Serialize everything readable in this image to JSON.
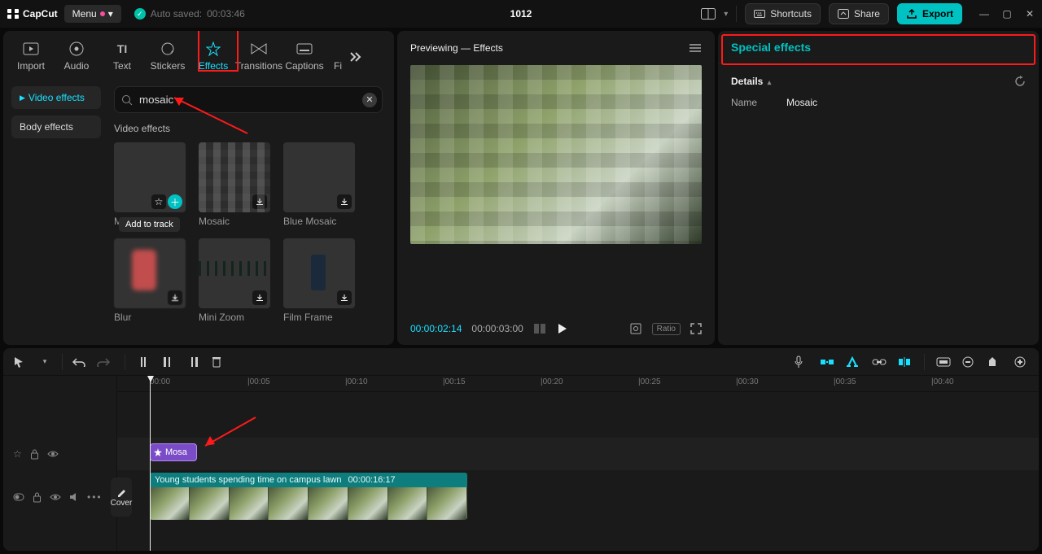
{
  "titlebar": {
    "app_name": "CapCut",
    "menu_label": "Menu",
    "autosave_label": "Auto saved:",
    "autosave_time": "00:03:46",
    "project_title": "1012",
    "shortcuts_label": "Shortcuts",
    "share_label": "Share",
    "export_label": "Export"
  },
  "library": {
    "tabs": [
      {
        "key": "import",
        "label": "Import"
      },
      {
        "key": "audio",
        "label": "Audio"
      },
      {
        "key": "text",
        "label": "Text"
      },
      {
        "key": "stickers",
        "label": "Stickers"
      },
      {
        "key": "effects",
        "label": "Effects"
      },
      {
        "key": "transitions",
        "label": "Transitions"
      },
      {
        "key": "captions",
        "label": "Captions"
      },
      {
        "key": "filters",
        "label": "Fi"
      }
    ],
    "active_tab": "effects",
    "side": {
      "video_effects": "Video effects",
      "body_effects": "Body effects"
    },
    "search_value": "mosaic",
    "group_title": "Video effects",
    "items": [
      {
        "name": "Mosaic",
        "thumb": "pixelate",
        "tooltip": "Add to track",
        "has_add": true,
        "has_star": true
      },
      {
        "name": "Mosaic",
        "thumb": "person-orange",
        "has_download": true
      },
      {
        "name": "Blue Mosaic",
        "thumb": "blue-mono",
        "has_download": true
      },
      {
        "name": "Blur",
        "thumb": "blur-thumb",
        "has_download": true
      },
      {
        "name": "Mini Zoom",
        "thumb": "field-thumb",
        "has_download": true
      },
      {
        "name": "Film Frame",
        "thumb": "film-thumb",
        "has_download": true
      }
    ]
  },
  "preview": {
    "title": "Previewing — Effects",
    "current_time": "00:00:02:14",
    "duration": "00:00:03:00",
    "ratio_label": "Ratio"
  },
  "inspector": {
    "title": "Special effects",
    "details_label": "Details",
    "name_key": "Name",
    "name_val": "Mosaic"
  },
  "timeline": {
    "cover_label": "Cover",
    "ruler": [
      "00:00",
      "|00:05",
      "|00:10",
      "|00:15",
      "|00:20",
      "|00:25",
      "|00:30",
      "|00:35",
      "|00:40"
    ],
    "fx_clip_label": "Mosa",
    "clip_title": "Young students spending time on campus lawn",
    "clip_duration": "00:00:16:17"
  }
}
